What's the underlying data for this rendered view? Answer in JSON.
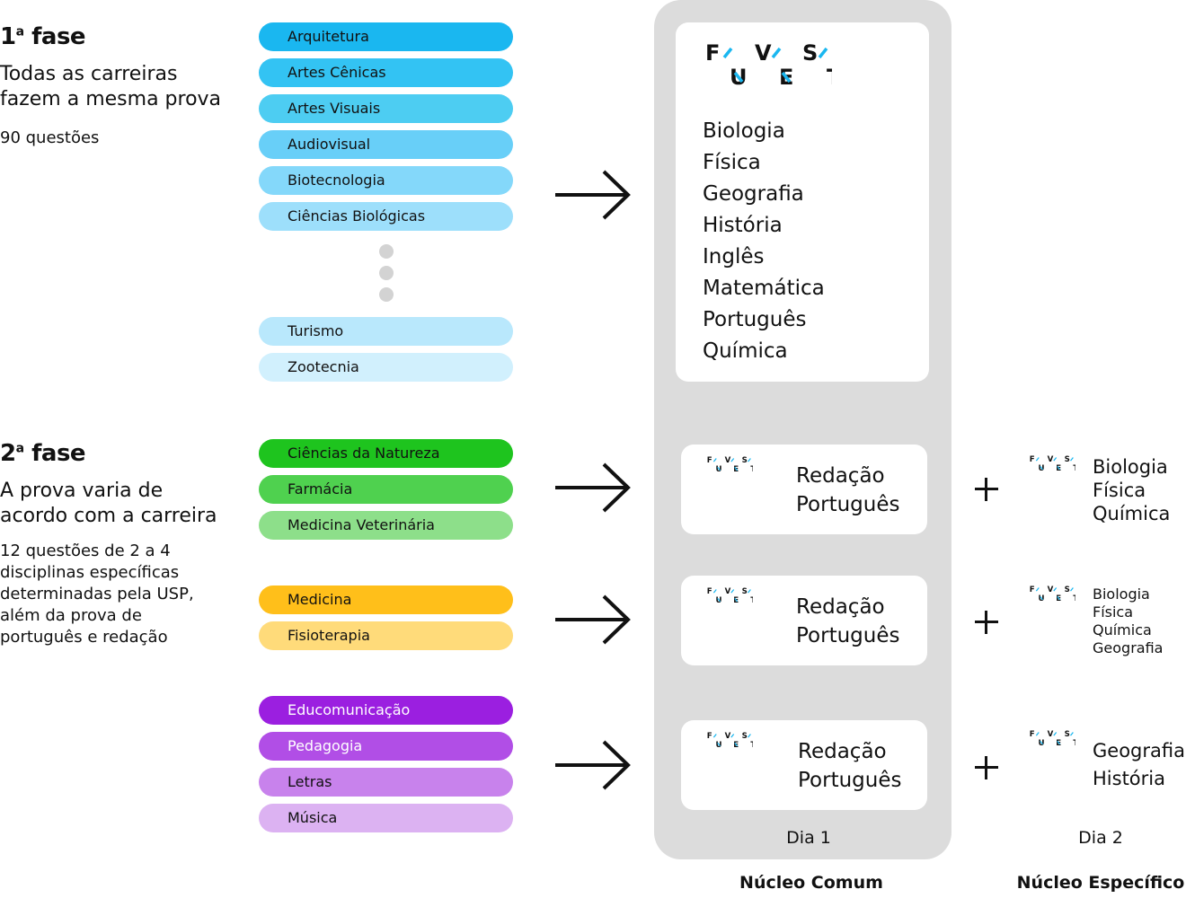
{
  "phase1": {
    "title_num": "1",
    "title_sup": "a",
    "title_word": " fase",
    "description": "Todas as carreiras fazem a mesma prova",
    "note": "90 questões"
  },
  "phase2": {
    "title_num": "2",
    "title_sup": "a",
    "title_word": " fase",
    "description": "A prova varia de acordo com a carreira",
    "note": "12 questões de 2 a 4 disciplinas específicas determinadas pela USP, além da prova de português e redação"
  },
  "careers_phase1": [
    {
      "label": "Arquitetura",
      "color": "#1ab7f0",
      "text": "#111111"
    },
    {
      "label": "Artes Cênicas",
      "color": "#33c3f3",
      "text": "#111111"
    },
    {
      "label": "Artes Visuais",
      "color": "#4dcdf2",
      "text": "#111111"
    },
    {
      "label": "Audiovisual",
      "color": "#68cff8",
      "text": "#111111"
    },
    {
      "label": "Biotecnologia",
      "color": "#84d8fa",
      "text": "#111111"
    },
    {
      "label": "Ciências Biológicas",
      "color": "#9ddffb",
      "text": "#111111"
    },
    {
      "label": "Turismo",
      "color": "#b9e8fc",
      "text": "#111111"
    },
    {
      "label": "Zootecnia",
      "color": "#d1f0fd",
      "text": "#111111"
    }
  ],
  "careers_group_natureza": [
    {
      "label": "Ciências da Natureza",
      "color": "#1ec41e",
      "text": "#111111"
    },
    {
      "label": "Farmácia",
      "color": "#4fd14f",
      "text": "#111111"
    },
    {
      "label": "Medicina Veterinária",
      "color": "#8ddf8a",
      "text": "#111111"
    }
  ],
  "careers_group_medicina": [
    {
      "label": "Medicina",
      "color": "#ffbf1a",
      "text": "#111111"
    },
    {
      "label": "Fisioterapia",
      "color": "#ffdb7a",
      "text": "#111111"
    }
  ],
  "careers_group_humanas": [
    {
      "label": "Educomunicação",
      "color": "#9b1fe0",
      "text": "#ffffff"
    },
    {
      "label": "Pedagogia",
      "color": "#b14ee6",
      "text": "#ffffff"
    },
    {
      "label": "Letras",
      "color": "#c882ec",
      "text": "#111111"
    },
    {
      "label": "Música",
      "color": "#dcb2f2",
      "text": "#111111"
    }
  ],
  "logo": {
    "row1": [
      "F",
      "V",
      "S"
    ],
    "row2": [
      "U",
      "E",
      "T"
    ],
    "accent": "#1ab7f0"
  },
  "phase1_subjects": [
    "Biologia",
    "Física",
    "Geografia",
    "História",
    "Inglês",
    "Matemática",
    "Português",
    "Química"
  ],
  "day1_subjects": [
    "Redação",
    "Português"
  ],
  "day2_natureza": [
    "Biologia",
    "Física",
    "Química"
  ],
  "day2_medicina": [
    "Biologia",
    "Física",
    "Química",
    "Geografia"
  ],
  "day2_humanas": [
    "Geografia",
    "História"
  ],
  "labels": {
    "dia1": "Dia 1",
    "dia2": "Dia 2",
    "nucleo_comum": "Núcleo Comum",
    "nucleo_especifico": "Núcleo Específico"
  }
}
